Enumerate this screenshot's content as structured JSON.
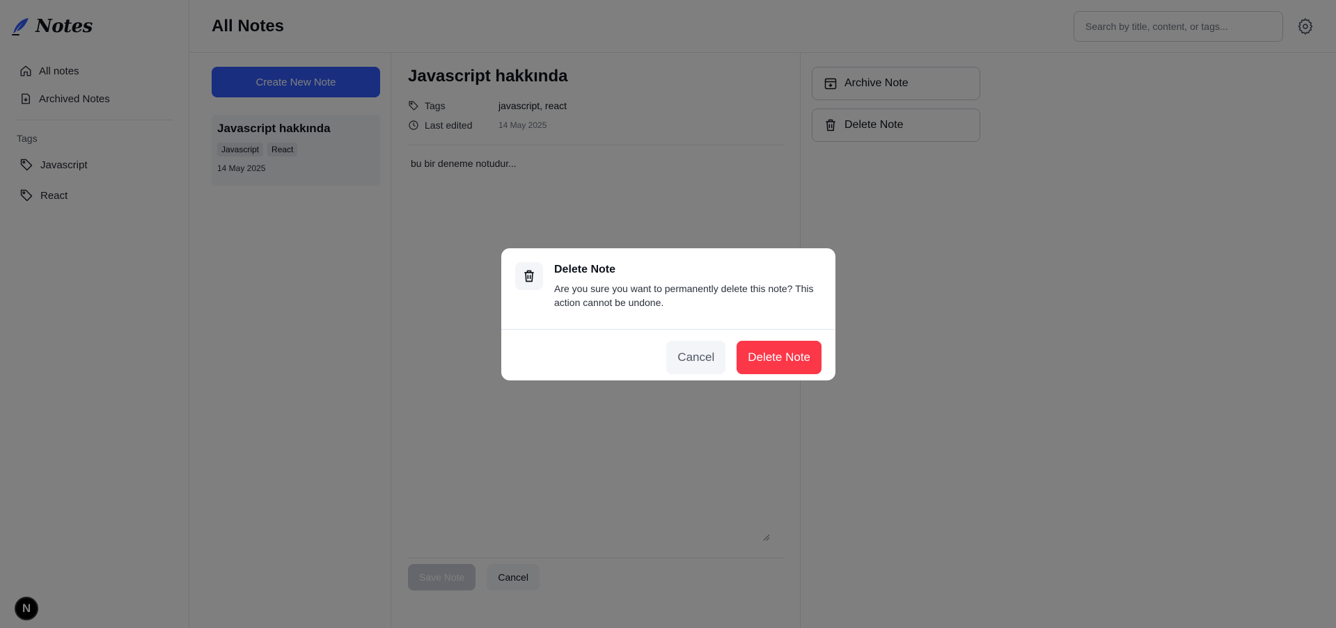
{
  "app": {
    "logo_text": "Notes"
  },
  "sidebar": {
    "items": [
      {
        "label": "All notes",
        "icon": "home-icon"
      },
      {
        "label": "Archived Notes",
        "icon": "archive-icon"
      }
    ],
    "tags_heading": "Tags",
    "tags": [
      {
        "label": "Javascript",
        "icon": "tag-icon"
      },
      {
        "label": "React",
        "icon": "tag-icon"
      }
    ],
    "next_badge": "N"
  },
  "header": {
    "title": "All Notes",
    "search_placeholder": "Search by title, content, or tags..."
  },
  "notes_list": {
    "create_button": "Create New Note",
    "notes": [
      {
        "title": "Javascript hakkında",
        "tags": [
          "Javascript",
          "React"
        ],
        "date": "14 May 2025"
      }
    ]
  },
  "editor": {
    "title": "Javascript hakkında",
    "tags_label": "Tags",
    "tags_value": "javascript, react",
    "last_edited_label": "Last edited",
    "last_edited_value": "14 May 2025",
    "body": "bu bir deneme notudur...",
    "save_button": "Save Note",
    "cancel_button": "Cancel"
  },
  "actions": {
    "archive_button": "Archive Note",
    "delete_button": "Delete Note"
  },
  "modal": {
    "title": "Delete Note",
    "text": "Are you sure you want to permanently delete this note? This action cannot be undone.",
    "cancel_button": "Cancel",
    "delete_button": "Delete Note"
  },
  "colors": {
    "primary": "#335cff",
    "danger": "#fb3748",
    "overlay": "rgba(0,0,0,0.5)"
  }
}
